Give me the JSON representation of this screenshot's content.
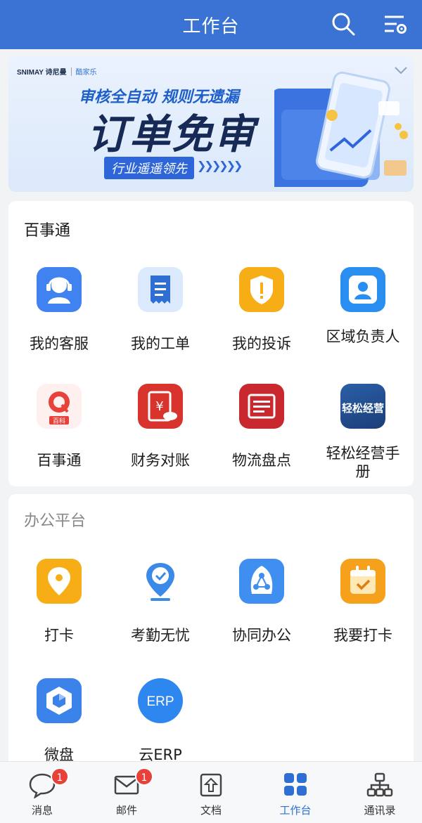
{
  "header": {
    "title": "工作台",
    "search_icon": "search-icon",
    "settings_icon": "settings-list-icon",
    "background": "#3a73d3"
  },
  "banner": {
    "brand": "SNIMAY 诗尼曼",
    "partner": "酷家乐",
    "subheadline": "审核全自动 规则无遗漏",
    "headline": "订单免审",
    "slogan": "行业遥遥领先",
    "accent": "#2e66d9"
  },
  "section_baishitong": {
    "title": "百事通",
    "items": [
      {
        "label": "我的客服",
        "icon": "customer-service-icon"
      },
      {
        "label": "我的工单",
        "icon": "work-order-icon"
      },
      {
        "label": "我的投诉",
        "icon": "complaint-shield-icon"
      },
      {
        "label": "区域负责人",
        "icon": "area-manager-icon"
      },
      {
        "label": "百事通",
        "icon": "baishitong-q-icon",
        "icon_text": "Q",
        "icon_caption": "百科"
      },
      {
        "label": "财务对账",
        "icon": "finance-reconcile-icon",
        "icon_text": "¥"
      },
      {
        "label": "物流盘点",
        "icon": "logistics-inventory-icon"
      },
      {
        "label": "轻松经营手册",
        "icon": "business-manual-icon",
        "icon_text": "轻松经营"
      }
    ]
  },
  "section_office": {
    "title": "办公平台",
    "items": [
      {
        "label": "打卡",
        "icon": "location-pin-icon"
      },
      {
        "label": "考勤无忧",
        "icon": "attendance-pin-icon"
      },
      {
        "label": "协同办公",
        "icon": "collaboration-icon"
      },
      {
        "label": "我要打卡",
        "icon": "calendar-check-icon"
      },
      {
        "label": "微盘",
        "icon": "cloud-drive-icon"
      },
      {
        "label": "云ERP",
        "icon": "erp-cloud-icon",
        "icon_text": "ERP"
      }
    ]
  },
  "bottom_nav": [
    {
      "label": "消息",
      "icon": "message-bubble-icon",
      "badge": "1"
    },
    {
      "label": "邮件",
      "icon": "mail-icon",
      "badge": "1"
    },
    {
      "label": "文档",
      "icon": "document-icon"
    },
    {
      "label": "工作台",
      "icon": "workbench-grid-icon",
      "active": true
    },
    {
      "label": "通讯录",
      "icon": "contacts-org-icon"
    }
  ]
}
